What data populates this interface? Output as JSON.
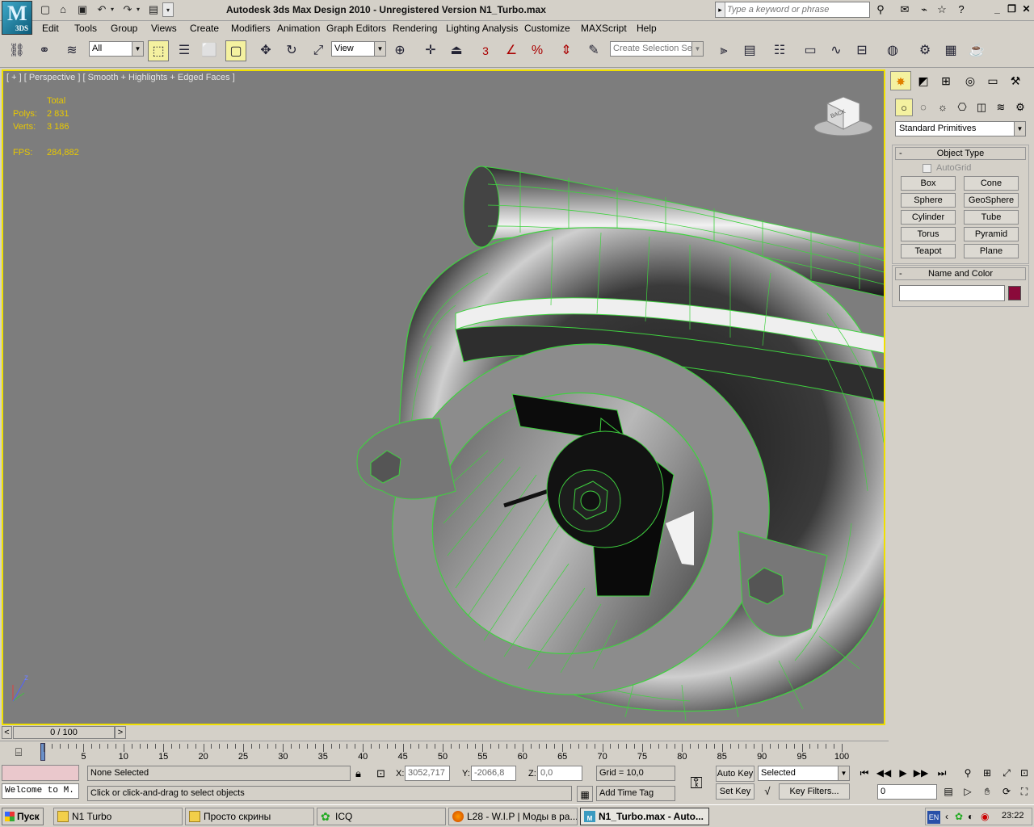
{
  "app": {
    "logo_text": "3DS",
    "title": "Autodesk 3ds Max Design 2010  -  Unregistered Version     N1_Turbo.max",
    "search_placeholder": "Type a keyword or phrase"
  },
  "menus": [
    "Edit",
    "Tools",
    "Group",
    "Views",
    "Create",
    "Modifiers",
    "Animation",
    "Graph Editors",
    "Rendering",
    "Lighting Analysis",
    "Customize",
    "MAXScript",
    "Help"
  ],
  "toolbar": {
    "selection_filter": "All",
    "ref_coord": "View",
    "named_selection_placeholder": "Create Selection Se",
    "snap_label": "3",
    "percent_label": "%"
  },
  "viewport": {
    "label": "[ + ] [ Perspective ] [ Smooth + Highlights + Edged Faces ]",
    "stats_header": "Total",
    "polys_label": "Polys:",
    "polys_value": "2 831",
    "verts_label": "Verts:",
    "verts_value": "3 186",
    "fps_label": "FPS:",
    "fps_value": "284,882",
    "viewcube_face": "BACK",
    "axis_label": "z"
  },
  "command_panel": {
    "category": "Standard Primitives",
    "object_type_title": "Object Type",
    "autogrid_label": "AutoGrid",
    "objects": [
      "Box",
      "Cone",
      "Sphere",
      "GeoSphere",
      "Cylinder",
      "Tube",
      "Torus",
      "Pyramid",
      "Teapot",
      "Plane"
    ],
    "name_color_title": "Name and Color",
    "object_name": "",
    "object_color": "#8a0a3a"
  },
  "timeline": {
    "slider_text": "0 / 100",
    "prev": "<",
    "next": ">",
    "ticks": [
      "0",
      "5",
      "10",
      "15",
      "20",
      "25",
      "30",
      "35",
      "40",
      "45",
      "50",
      "55",
      "60",
      "65",
      "70",
      "75",
      "80",
      "85",
      "90",
      "95",
      "100"
    ]
  },
  "status": {
    "maxscript_listener": "Welcome to M.",
    "selection_status": "None Selected",
    "prompt": "Click or click-and-drag to select objects",
    "x_label": "X:",
    "x_value": "3052,717",
    "y_label": "Y:",
    "y_value": "-2066,8",
    "z_label": "Z:",
    "z_value": "0,0",
    "grid": "Grid = 10,0",
    "add_time_tag": "Add Time Tag",
    "auto_key": "Auto Key",
    "set_key": "Set Key",
    "key_mode": "Selected",
    "key_filters": "Key Filters...",
    "current_frame": "0"
  },
  "taskbar": {
    "start": "Пуск",
    "tasks": [
      "N1 Turbo",
      "Просто скрины",
      "ICQ",
      "L28 - W.I.P | Моды в ра...",
      "N1_Turbo.max - Auto..."
    ],
    "active_index": 4,
    "lang": "EN",
    "clock": "23:22"
  }
}
